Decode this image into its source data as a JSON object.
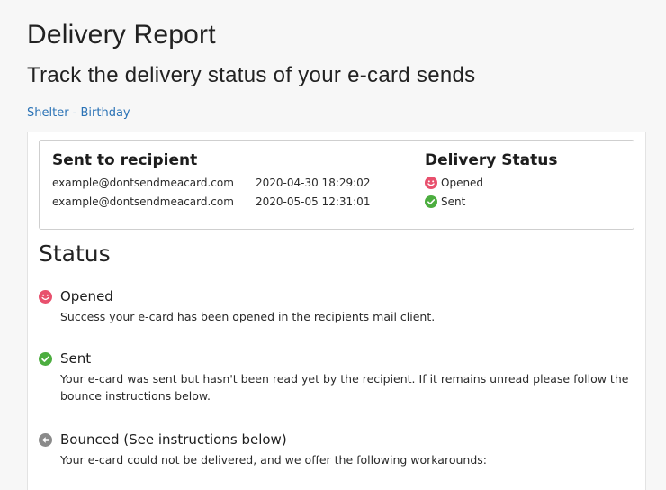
{
  "header": {
    "title": "Delivery Report",
    "subtitle": "Track the delivery status of your e-card sends",
    "campaign_link": "Shelter - Birthday"
  },
  "recipients_table": {
    "columns": {
      "recipient": "Sent to recipient",
      "status": "Delivery Status"
    },
    "rows": [
      {
        "email": "example@dontsendmeacard.com",
        "sent_at": "2020-04-30 18:29:02",
        "status": "Opened",
        "status_icon": "smiley-icon"
      },
      {
        "email": "example@dontsendmeacard.com",
        "sent_at": "2020-05-05 12:31:01",
        "status": "Sent",
        "status_icon": "check-circle-icon"
      }
    ]
  },
  "status_legend": {
    "heading": "Status",
    "items": [
      {
        "title": "Opened",
        "description": "Success your e-card has been opened in the recipients mail client.",
        "icon": "smiley-icon"
      },
      {
        "title": "Sent",
        "description": "Your e-card was sent but hasn't been read yet by the recipient. If it remains unread please follow the bounce instructions below.",
        "icon": "check-circle-icon"
      },
      {
        "title": "Bounced (See instructions below)",
        "description": "Your e-card could not be delivered, and we offer the following workarounds:",
        "icon": "back-arrow-circle-icon"
      }
    ]
  },
  "colors": {
    "link": "#2b73b6",
    "opened": "#e8506d",
    "sent": "#4cad3f",
    "bounced": "#8a8a8a"
  }
}
